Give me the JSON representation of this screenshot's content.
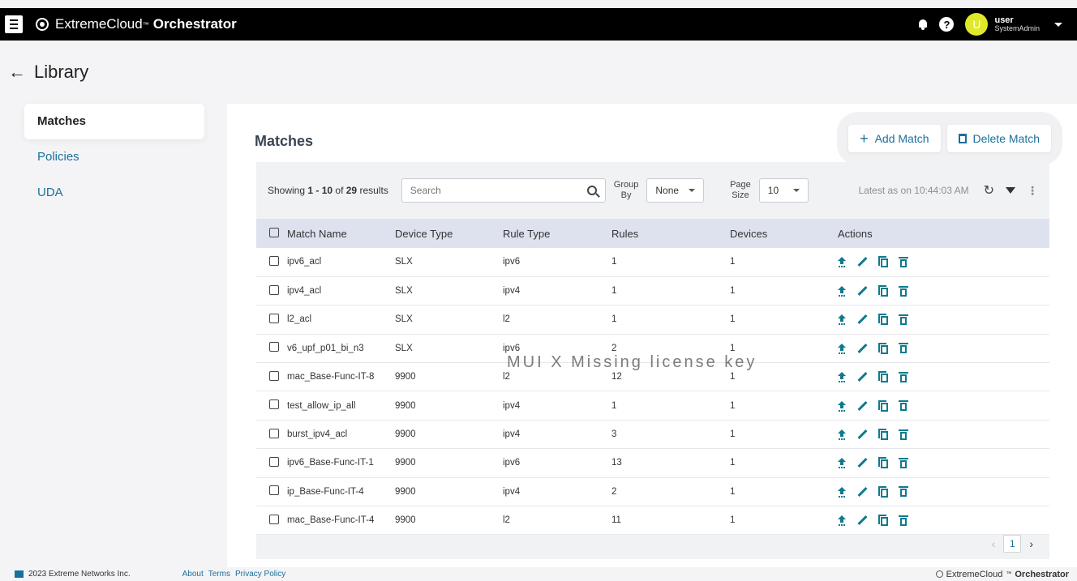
{
  "topbar": {
    "brand_light": "ExtremeCloud",
    "brand_tm": "™",
    "brand_bold": "Orchestrator",
    "help_label": "?",
    "avatar_letter": "U",
    "user_name": "user",
    "user_role": "SystemAdmin"
  },
  "page": {
    "back_arrow": "←",
    "title": "Library"
  },
  "sidebar": {
    "items": [
      {
        "label": "Matches"
      },
      {
        "label": "Policies"
      },
      {
        "label": "UDA"
      }
    ]
  },
  "main": {
    "title": "Matches",
    "add_button": "Add Match",
    "delete_button": "Delete Match",
    "toolbar": {
      "showing_prefix": "Showing ",
      "showing_range": "1 - 10",
      "showing_mid": " of ",
      "showing_total": "29",
      "showing_suffix": " results",
      "search_placeholder": "Search",
      "group_by_label_1": "Group",
      "group_by_label_2": "By",
      "group_by_value": "None",
      "page_size_label_1": "Page",
      "page_size_label_2": "Size",
      "page_size_value": "10",
      "latest": "Latest as on 10:44:03 AM"
    },
    "columns": [
      "Match Name",
      "Device Type",
      "Rule Type",
      "Rules",
      "Devices",
      "Actions"
    ],
    "rows": [
      {
        "name": "ipv6_acl",
        "device_type": "SLX",
        "rule_type": "ipv6",
        "rules": "1",
        "devices": "1"
      },
      {
        "name": "ipv4_acl",
        "device_type": "SLX",
        "rule_type": "ipv4",
        "rules": "1",
        "devices": "1"
      },
      {
        "name": "l2_acl",
        "device_type": "SLX",
        "rule_type": "l2",
        "rules": "1",
        "devices": "1"
      },
      {
        "name": "v6_upf_p01_bi_n3",
        "device_type": "SLX",
        "rule_type": "ipv6",
        "rules": "2",
        "devices": "1"
      },
      {
        "name": "mac_Base-Func-IT-8",
        "device_type": "9900",
        "rule_type": "l2",
        "rules": "12",
        "devices": "1"
      },
      {
        "name": "test_allow_ip_all",
        "device_type": "9900",
        "rule_type": "ipv4",
        "rules": "1",
        "devices": "1"
      },
      {
        "name": "burst_ipv4_acl",
        "device_type": "9900",
        "rule_type": "ipv4",
        "rules": "3",
        "devices": "1"
      },
      {
        "name": "ipv6_Base-Func-IT-1",
        "device_type": "9900",
        "rule_type": "ipv6",
        "rules": "13",
        "devices": "1"
      },
      {
        "name": "ip_Base-Func-IT-4",
        "device_type": "9900",
        "rule_type": "ipv4",
        "rules": "2",
        "devices": "1"
      },
      {
        "name": "mac_Base-Func-IT-4",
        "device_type": "9900",
        "rule_type": "l2",
        "rules": "11",
        "devices": "1"
      }
    ],
    "watermark": "MUI X Missing license key",
    "pager": {
      "prev": "‹",
      "current": "1",
      "next": "›"
    }
  },
  "footer": {
    "copyright": "2023 Extreme Networks Inc.",
    "links": [
      "About",
      "Terms",
      "Privacy Policy"
    ],
    "brand_light": "ExtremeCloud",
    "brand_tm": "™",
    "brand_bold": "Orchestrator"
  },
  "colors": {
    "accent": "#1a6f9a",
    "action_icon": "#0e7a8e",
    "topbar": "#000000",
    "avatar": "#e0e928",
    "header_row": "#dde2ee"
  }
}
